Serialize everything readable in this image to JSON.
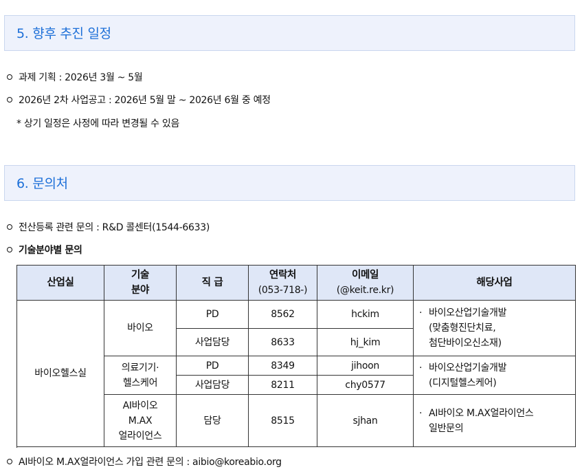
{
  "section5": {
    "title": "5. 향후 추진 일정",
    "items": [
      "과제 기획 : 2026년 3월 ~ 5월",
      "2026년 2차 사업공고 : 2026년 5월 말 ~ 2026년 6월 중 예정"
    ],
    "note": "* 상기 일정은 사정에 따라 변경될 수 있음"
  },
  "section6": {
    "title": "6. 문의처",
    "item1": "전산등록 관련 문의 : R&D 콜센터(1544-6633)",
    "item2": "기술분야별 문의",
    "footer_item": "AI바이오 M.AX얼라이언스 가입 관련 문의 : aibio@koreabio.org"
  },
  "table": {
    "headers": {
      "dept": "산업실",
      "field_l1": "기술",
      "field_l2": "분야",
      "position": "직 급",
      "contact_l1": "연락처",
      "contact_l2": "(053-718-)",
      "email_l1": "이메일",
      "email_l2": "(@keit.re.kr)",
      "biz": "해당사업"
    },
    "dept": "바이오헬스실",
    "bullet": "·",
    "groups": {
      "bio": {
        "field": "바이오",
        "rows": [
          {
            "position": "PD",
            "contact": "8562",
            "email": "hckim"
          },
          {
            "position": "사업담당",
            "contact": "8633",
            "email": "hj_kim"
          }
        ],
        "biz_l1": "바이오산업기술개발",
        "biz_l2": "(맞춤형진단치료,",
        "biz_l3": "첨단바이오신소재)"
      },
      "med": {
        "field_l1": "의료기기·",
        "field_l2": "헬스케어",
        "rows": [
          {
            "position": "PD",
            "contact": "8349",
            "email": "jihoon"
          },
          {
            "position": "사업담당",
            "contact": "8211",
            "email": "chy0577"
          }
        ],
        "biz_l1": "바이오산업기술개발",
        "biz_l2": "(디지털헬스케어)"
      },
      "ai": {
        "field_l1": "AI바이오",
        "field_l2": "M.AX",
        "field_l3": "얼라이언스",
        "position": "담당",
        "contact": "8515",
        "email": "sjhan",
        "biz_l1": "AI바이오 M.AX얼라이언스",
        "biz_l2": "일반문의"
      }
    }
  }
}
